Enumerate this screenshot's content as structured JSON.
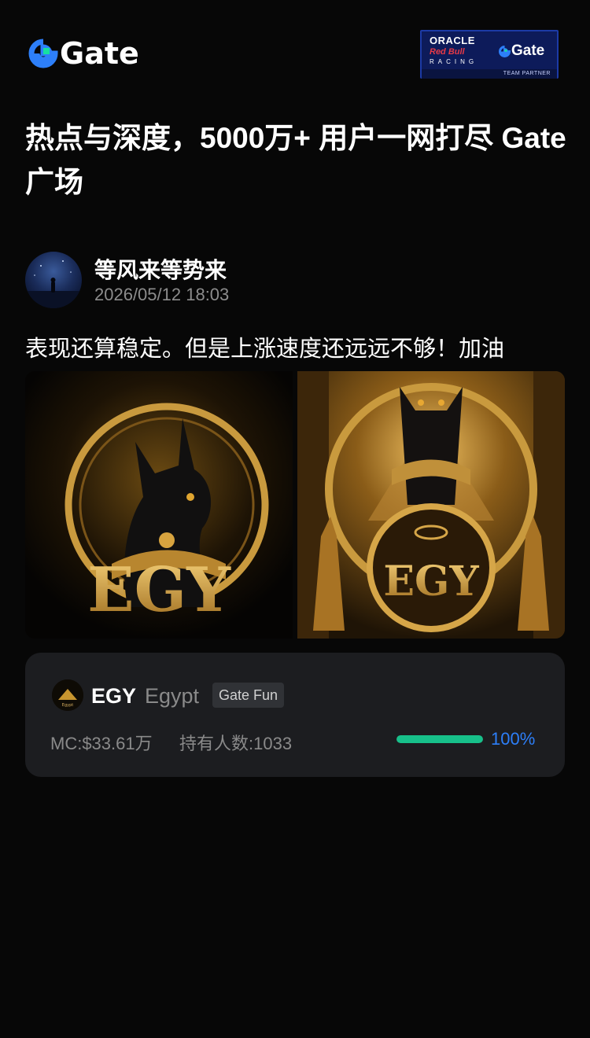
{
  "header": {
    "logo_text": "Gate",
    "partner": {
      "oracle": "ORACLE",
      "redbull": "Red Bull",
      "racing": "RACING",
      "gate": "Gate",
      "team": "TEAM PARTNER"
    }
  },
  "headline": "热点与深度，5000万+ 用户一网打尽 Gate 广场",
  "post": {
    "author": "等风来等势来",
    "time": "2026/05/12 18:03",
    "text": "表现还算稳定。但是上涨速度还远远不够！加油",
    "image_labels": [
      "EGY",
      "EGY"
    ]
  },
  "token": {
    "symbol": "EGY",
    "name": "Egypt",
    "badge": "Gate Fun",
    "icon_label": "Egypt",
    "mc": "MC:$33.61万",
    "holders": "持有人数:1033",
    "progress_label": "100%",
    "progress_fraction": 1.0
  },
  "colors": {
    "background": "#070707",
    "brand_blue": "#2d7ff9",
    "progress_green": "#17c08a",
    "card": "#1c1d20"
  }
}
